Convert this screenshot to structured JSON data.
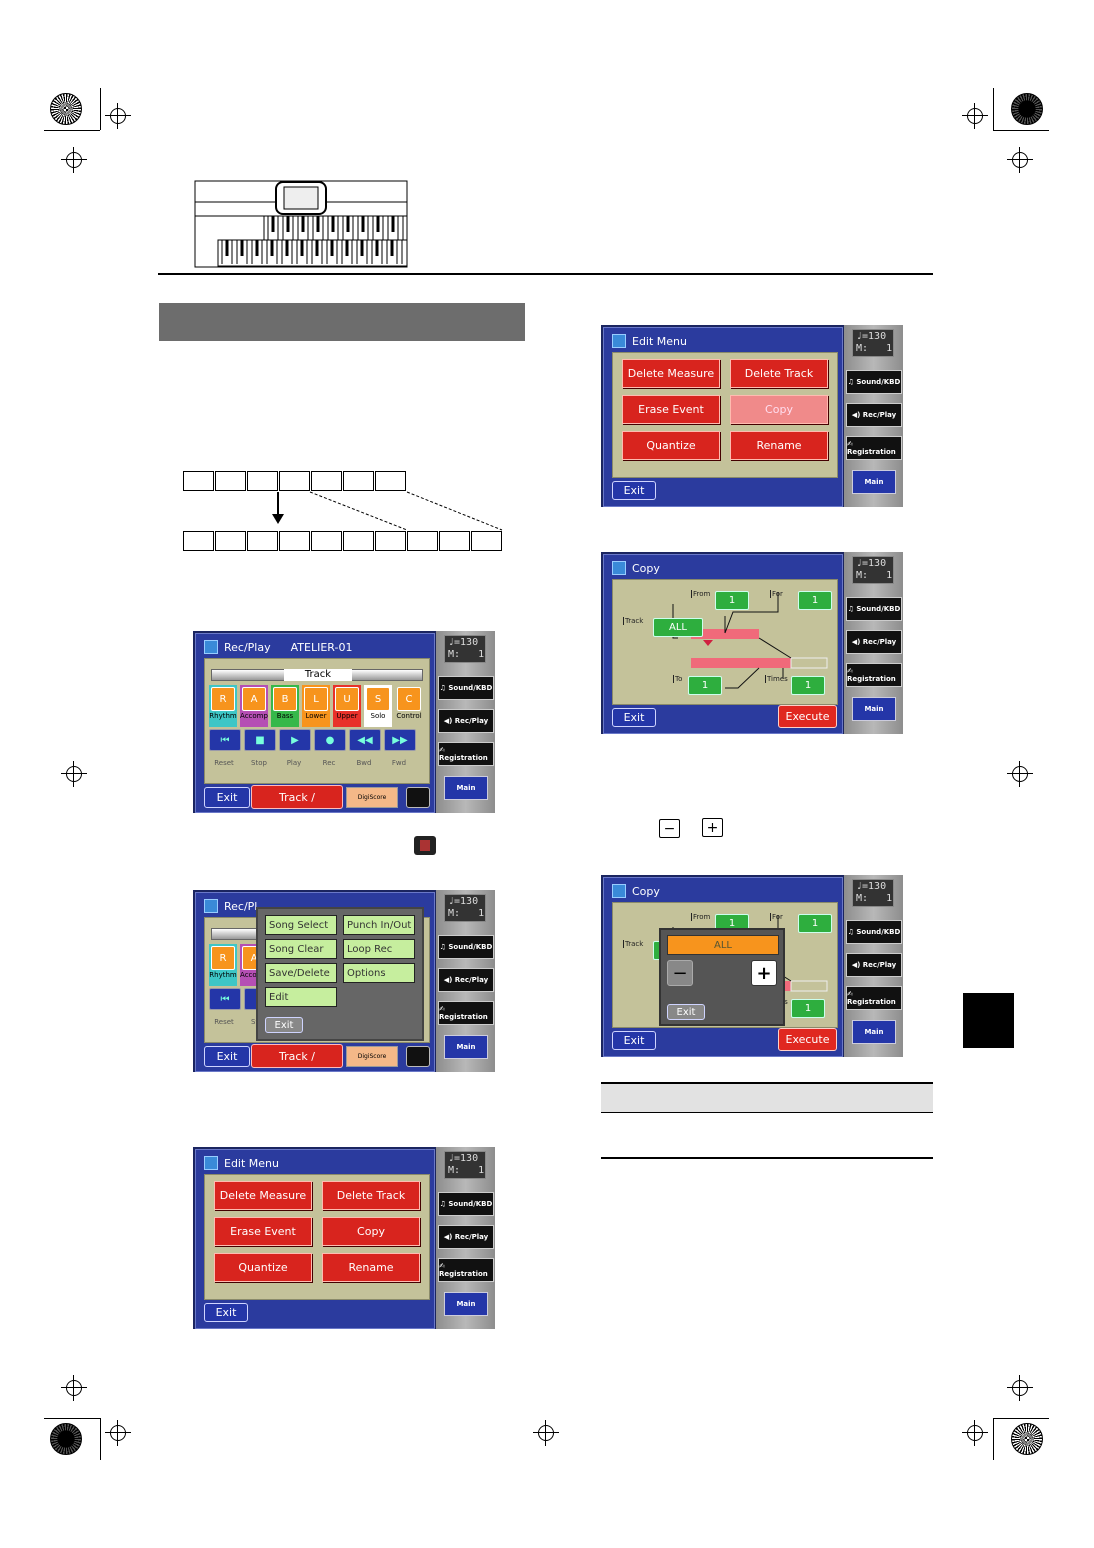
{
  "tempo": "♩=130\nM:   1",
  "side": {
    "sound": "♫ Sound/KBD",
    "recplay": "◀) Rec/Play",
    "registration": "✍ Registration",
    "main": "Main"
  },
  "recplay": {
    "title": "Rec/Play",
    "song": "ATELIER-01",
    "track_bar": "Track",
    "tracks": [
      {
        "key": "R",
        "label": "Rhythm",
        "bg": "#3ec6c6"
      },
      {
        "key": "A",
        "label": "Accomp",
        "bg": "#b54fb4"
      },
      {
        "key": "B",
        "label": "Bass",
        "bg": "#36b84a"
      },
      {
        "key": "L",
        "label": "Lower",
        "bg": "#f7941d"
      },
      {
        "key": "U",
        "label": "Upper",
        "bg": "#e8312a"
      },
      {
        "key": "S",
        "label": "Solo",
        "bg": "#ffffff"
      },
      {
        "key": "C",
        "label": "Control",
        "bg": "#c4c29a"
      }
    ],
    "transport": [
      {
        "icon": "⏮",
        "label": "Reset"
      },
      {
        "icon": "■",
        "label": "Stop"
      },
      {
        "icon": "▶",
        "label": "Play"
      },
      {
        "icon": "●",
        "label": "Rec"
      },
      {
        "icon": "◀◀",
        "label": "Bwd"
      },
      {
        "icon": "▶▶",
        "label": "Fwd"
      }
    ],
    "exit": "Exit",
    "track_button": "Track /",
    "digiscore": "DigiScore"
  },
  "recmenu": {
    "title": "Rec/Pl",
    "items": [
      "Song Select",
      "Punch In/Out",
      "Song Clear",
      "Loop Rec",
      "Save/Delete",
      "Options",
      "Edit"
    ],
    "exit": "Exit"
  },
  "editmenu": {
    "title": "Edit Menu",
    "items": [
      "Delete Measure",
      "Delete Track",
      "Erase Event",
      "Copy",
      "Quantize",
      "Rename"
    ],
    "exit": "Exit"
  },
  "copy": {
    "title": "Copy",
    "from_label": "From",
    "from": "1",
    "for_label": "For",
    "for": "1",
    "track_label": "Track",
    "track": "ALL",
    "to_label": "To",
    "to": "1",
    "times_label": "Times",
    "times": "1",
    "exit": "Exit",
    "execute": "Execute"
  },
  "popup": {
    "value": "ALL",
    "minus": "−",
    "plus": "+",
    "exit": "Exit"
  },
  "inline_buttons": {
    "minus": "−",
    "plus": "+"
  },
  "colors": {
    "screen_blue": "#2b3b9e",
    "panel_beige": "#c4c29a",
    "button_red": "#d8241e",
    "button_green": "#2eae3e",
    "popup_orange": "#f7941d"
  }
}
